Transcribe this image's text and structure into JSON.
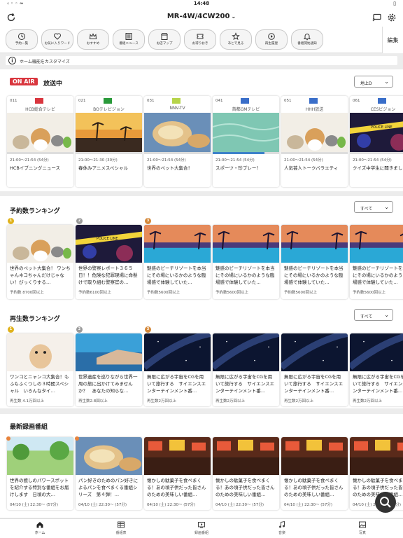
{
  "status": {
    "time": "14:48",
    "left": "‹ ◦ ◦ ≈",
    "right": "▯"
  },
  "header": {
    "title": "MR-4W/4CW200",
    "chevron": "⌄"
  },
  "quick_items": [
    {
      "label": "予約一覧",
      "icon": "clock-list-icon"
    },
    {
      "label": "お気に入りワード",
      "icon": "heart-search-icon"
    },
    {
      "label": "おすすめ",
      "icon": "crown-icon"
    },
    {
      "label": "番組ニュース",
      "icon": "news-icon"
    },
    {
      "label": "お店マップ",
      "icon": "shop-icon"
    },
    {
      "label": "お得りおき",
      "icon": "coupon-icon"
    },
    {
      "label": "あとで見る",
      "icon": "star-icon"
    },
    {
      "label": "再生履歴",
      "icon": "history-icon"
    },
    {
      "label": "番組開始通知",
      "icon": "bell-icon"
    }
  ],
  "edit_label": "編集",
  "customize_label": "ホーム機能をカスタマイズ",
  "onair": {
    "badge": "ON AIR",
    "title": "放送中",
    "dropdown": "地上D",
    "cards": [
      {
        "num": "011",
        "logo_color": "#d9363e",
        "channel": "HCB総合テレビ",
        "time": "21:00～21:54 (54分)",
        "title": "HCBイブニングニュース",
        "thumb": "animals",
        "progress": 0.0
      },
      {
        "num": "021",
        "logo_color": "#2a9a3a",
        "channel": "BOテレビジョン",
        "time": "21:00～21:30 (30分)",
        "title": "春休みアニメスペシャル",
        "thumb": "sunset",
        "progress": 0.0
      },
      {
        "num": "031",
        "logo_color": "#b6d44a",
        "channel": "NNV-TV",
        "time": "21:00～21:54 (54分)",
        "title": "世界のペット大集合！",
        "thumb": "bread",
        "progress": 0.0
      },
      {
        "num": "041",
        "logo_color": "#3a6ec9",
        "channel": "首都GMテレビ",
        "time": "21:00～21:54 (54分)",
        "title": "スポーツ・珍プレー！",
        "thumb": "water",
        "progress": 0.78
      },
      {
        "num": "051",
        "logo_color": "#3a6ec9",
        "channel": "HHH放送",
        "time": "21:00～21:54 (54分)",
        "title": "人気芸人トークバラエティ",
        "thumb": "animals",
        "progress": 0.0
      },
      {
        "num": "061",
        "logo_color": "#3a6ec9",
        "channel": "CESビジョン",
        "time": "21:00～21:54 (54分)",
        "title": "クイズ中学生に聞きまし",
        "thumb": "police",
        "progress": 0.0
      }
    ]
  },
  "reserve_ranking": {
    "title": "予約数ランキング",
    "dropdown": "すべて",
    "cards": [
      {
        "rank": "1",
        "rank_color": "#e0b21c",
        "thumb": "animals",
        "title": "世界のペット大集合！ ワンちゃんネコちゃんだけじゃない！びっくりする…",
        "meta": "予約数 8700回以上"
      },
      {
        "rank": "2",
        "rank_color": "#9a9a9a",
        "thumb": "police",
        "title": "世界の警察レポート３６５日！！危険な犯罪現場に命懸けで取り組む警察官の…",
        "meta": "予約数6100回以上"
      },
      {
        "rank": "3",
        "rank_color": "#d4883a",
        "thumb": "resort",
        "title": "魅惑のビーチリゾートを本当にその場にいるかのような臨場感で体験していた…",
        "meta": "予約数5600回以上"
      },
      {
        "rank": "",
        "rank_color": "",
        "thumb": "resort",
        "title": "魅惑のビーチリゾートを本当にその場にいるかのような臨場感で体験していた…",
        "meta": "予約数5600回以上"
      },
      {
        "rank": "",
        "rank_color": "",
        "thumb": "resort",
        "title": "魅惑のビーチリゾートを本当にその場にいるかのような臨場感で体験していた…",
        "meta": "予約数5600回以上"
      },
      {
        "rank": "",
        "rank_color": "",
        "thumb": "resort",
        "title": "魅惑のビーチリゾートを本当にその場にいるかのような臨場感で体験していた…",
        "meta": "予約数5600回以上"
      }
    ]
  },
  "play_ranking": {
    "title": "再生数ランキング",
    "dropdown": "すべて",
    "cards": [
      {
        "rank": "1",
        "rank_color": "#e0b21c",
        "thumb": "dog",
        "title": "ワンコとニャンコ大集合！もふもふくつしの３時間スペシャル　いろんなタイ…",
        "meta": "再生数 4.1万回以上"
      },
      {
        "rank": "2",
        "rank_color": "#9a9a9a",
        "thumb": "coast",
        "title": "世界遺産を巡りながら世界一周の旅に出かけてみませんか？　あなたの知らな…",
        "meta": "再生数2.8回以上"
      },
      {
        "rank": "3",
        "rank_color": "#d4883a",
        "thumb": "galaxy",
        "title": "無限に広がる宇宙をCGを用いて旅行する　サイエンスエンターテインメント番…",
        "meta": "再生数2万回以上"
      },
      {
        "rank": "",
        "rank_color": "",
        "thumb": "galaxy",
        "title": "無限に広がる宇宙をCGを用いて旅行する　サイエンスエンターテインメント番…",
        "meta": "再生数2万回以上"
      },
      {
        "rank": "",
        "rank_color": "",
        "thumb": "galaxy",
        "title": "無限に広がる宇宙をCGを用いて旅行する　サイエンスエンターテインメント番…",
        "meta": "再生数2万回以上"
      },
      {
        "rank": "",
        "rank_color": "",
        "thumb": "galaxy",
        "title": "無限に広がる宇宙をCGを用いて旅行する　サイエンスエンターテインメント番…",
        "meta": "再生数2万回以上"
      }
    ]
  },
  "latest": {
    "title": "最新録画番組",
    "cards": [
      {
        "dot": "#e8823a",
        "thumb": "park",
        "title": "世界の癒しのパワースポットを紹介する特別な番組をお届けします　日頃の大…",
        "meta": "04/10 (土) 22:30～ (57分)"
      },
      {
        "dot": "#e8823a",
        "thumb": "bread",
        "title": "パン好きのためのパン好きによるパンを食べまくる番組シリーズ　第４弾！…",
        "meta": "04/10 (土) 22:30～ (57分)"
      },
      {
        "dot": "",
        "thumb": "market",
        "title": "懐かしの駄菓子を食べまくる！あの頃子供だった皆さんのための美味しい番組…",
        "meta": "04/10 (土) 22:30～ (57分)"
      },
      {
        "dot": "",
        "thumb": "market",
        "title": "懐かしの駄菓子を食べまくる！あの頃子供だった皆さんのための美味しい番組…",
        "meta": "04/10 (土) 22:30～ (57分)"
      },
      {
        "dot": "",
        "thumb": "market",
        "title": "懐かしの駄菓子を食べまくる！あの頃子供だった皆さんのための美味しい番組…",
        "meta": "04/10 (土) 22:30～ (57分)"
      },
      {
        "dot": "",
        "thumb": "market",
        "title": "懐かしの駄菓子を食べまくる！あの頃子供だった皆さんのための美味しい番組…",
        "meta": "04/10 (土) 22:30～ (57分)"
      }
    ]
  },
  "nav": [
    {
      "label": "ホーム",
      "icon": "home-icon",
      "active": true
    },
    {
      "label": "番組表",
      "icon": "tv-guide-icon",
      "active": false
    },
    {
      "label": "録画番組",
      "icon": "recorded-icon",
      "active": false
    },
    {
      "label": "音楽",
      "icon": "music-icon",
      "active": false
    },
    {
      "label": "写真",
      "icon": "photo-icon",
      "active": false
    }
  ],
  "colors": {
    "accent": "#d9363e",
    "progress": "#3d82c9"
  }
}
